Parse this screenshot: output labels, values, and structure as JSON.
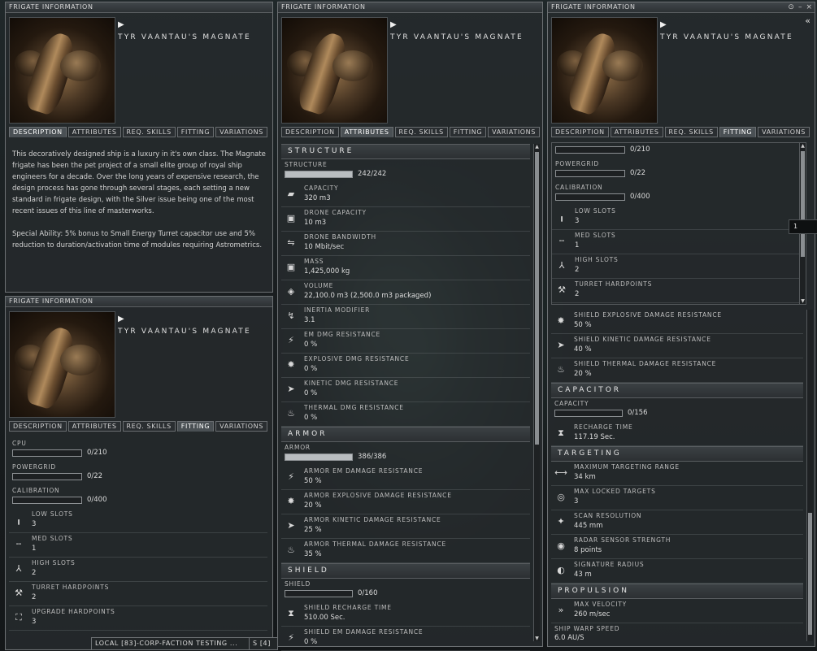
{
  "window_title": "FRIGATE INFORMATION",
  "ship_name": "TYR VAANTAU'S MAGNATE",
  "tabs": [
    "DESCRIPTION",
    "ATTRIBUTES",
    "REQ. SKILLS",
    "FITTING",
    "VARIATIONS"
  ],
  "window_controls": [
    "⊙",
    "–",
    "×"
  ],
  "collapse_glyph": "«",
  "play_glyph": "▶",
  "description": {
    "para1": "This decoratively designed ship is a luxury in it's own class. The Magnate frigate has been the pet project of a small elite group of royal ship engineers for a decade. Over the long years of expensive research, the design process has gone through several stages, each setting a new standard in frigate design, with the Silver issue being one of the most recent issues of this line of masterworks.",
    "para2": "Special Ability: 5% bonus to Small Energy Turret capacitor use and 5% reduction to duration/activation time of modules requiring Astrometrics."
  },
  "fitting": {
    "cpu_label": "CPU",
    "cpu_value": "0/210",
    "cpu_fill": 0,
    "powergrid_label": "POWERGRID",
    "powergrid_value": "0/22",
    "powergrid_fill": 0,
    "calibration_label": "CALIBRATION",
    "calibration_value": "0/400",
    "calibration_fill": 0,
    "low_label": "LOW SLOTS",
    "low_value": "3",
    "med_label": "MED SLOTS",
    "med_value": "1",
    "high_label": "HIGH SLOTS",
    "high_value": "2",
    "turret_label": "TURRET HARDPOINTS",
    "turret_value": "2",
    "upgrade_label": "UPGRADE HARDPOINTS",
    "upgrade_value": "3"
  },
  "attributes": {
    "structure_header": "STRUCTURE",
    "structure_label": "STRUCTURE",
    "structure_value": "242/242",
    "structure_fill": 1.0,
    "structure_rows": [
      {
        "icon": "cargo-icon",
        "glyph": "▰",
        "label": "CAPACITY",
        "value": "320 m3"
      },
      {
        "icon": "drone-capacity-icon",
        "glyph": "▣",
        "label": "DRONE CAPACITY",
        "value": "10 m3"
      },
      {
        "icon": "drone-bandwidth-icon",
        "glyph": "⇋",
        "label": "DRONE BANDWIDTH",
        "value": "10 Mbit/sec"
      },
      {
        "icon": "mass-icon",
        "glyph": "▣",
        "label": "MASS",
        "value": "1,425,000 kg"
      },
      {
        "icon": "volume-icon",
        "glyph": "◈",
        "label": "VOLUME",
        "value": "22,100.0 m3 (2,500.0 m3 packaged)"
      },
      {
        "icon": "inertia-icon",
        "glyph": "↯",
        "label": "INERTIA MODIFIER",
        "value": "3.1"
      },
      {
        "icon": "em-resist-icon",
        "glyph": "⚡",
        "label": "EM DMG RESISTANCE",
        "value": "0 %"
      },
      {
        "icon": "explosive-resist-icon",
        "glyph": "✸",
        "label": "EXPLOSIVE DMG RESISTANCE",
        "value": "0 %"
      },
      {
        "icon": "kinetic-resist-icon",
        "glyph": "➤",
        "label": "KINETIC DMG RESISTANCE",
        "value": "0 %"
      },
      {
        "icon": "thermal-resist-icon",
        "glyph": "♨",
        "label": "THERMAL DMG RESISTANCE",
        "value": "0 %"
      }
    ],
    "armor_header": "ARMOR",
    "armor_label": "ARMOR",
    "armor_value": "386/386",
    "armor_fill": 1.0,
    "armor_rows": [
      {
        "icon": "em-resist-icon",
        "glyph": "⚡",
        "label": "ARMOR EM DAMAGE RESISTANCE",
        "value": "50 %"
      },
      {
        "icon": "explosive-resist-icon",
        "glyph": "✸",
        "label": "ARMOR EXPLOSIVE DAMAGE RESISTANCE",
        "value": "20 %"
      },
      {
        "icon": "kinetic-resist-icon",
        "glyph": "➤",
        "label": "ARMOR KINETIC DAMAGE RESISTANCE",
        "value": "25 %"
      },
      {
        "icon": "thermal-resist-icon",
        "glyph": "♨",
        "label": "ARMOR THERMAL DAMAGE RESISTANCE",
        "value": "35 %"
      }
    ],
    "shield_header": "SHIELD",
    "shield_label": "SHIELD",
    "shield_value": "0/160",
    "shield_fill": 0,
    "shield_rows": [
      {
        "icon": "hourglass-icon",
        "glyph": "⧗",
        "label": "SHIELD RECHARGE TIME",
        "value": "510.00 Sec."
      },
      {
        "icon": "em-resist-icon",
        "glyph": "⚡",
        "label": "SHIELD EM DAMAGE RESISTANCE",
        "value": "0 %"
      }
    ]
  },
  "right_panel": {
    "top_rows": [
      {
        "icon": "explosive-resist-icon",
        "glyph": "✸",
        "label": "SHIELD EXPLOSIVE DAMAGE RESISTANCE",
        "value": "50 %"
      },
      {
        "icon": "kinetic-resist-icon",
        "glyph": "➤",
        "label": "SHIELD KINETIC DAMAGE RESISTANCE",
        "value": "40 %"
      },
      {
        "icon": "thermal-resist-icon",
        "glyph": "♨",
        "label": "SHIELD THERMAL DAMAGE RESISTANCE",
        "value": "20 %"
      }
    ],
    "capacitor_header": "CAPACITOR",
    "capacitor_label": "CAPACITY",
    "capacitor_value": "0/156",
    "capacitor_fill": 0,
    "capacitor_rows": [
      {
        "icon": "hourglass-icon",
        "glyph": "⧗",
        "label": "RECHARGE TIME",
        "value": "117.19 Sec."
      }
    ],
    "targeting_header": "TARGETING",
    "targeting_rows": [
      {
        "icon": "targeting-range-icon",
        "glyph": "⟷",
        "label": "MAXIMUM TARGETING RANGE",
        "value": "34 km"
      },
      {
        "icon": "locked-targets-icon",
        "glyph": "◎",
        "label": "MAX LOCKED TARGETS",
        "value": "3"
      },
      {
        "icon": "scan-resolution-icon",
        "glyph": "✦",
        "label": "SCAN RESOLUTION",
        "value": "445 mm"
      },
      {
        "icon": "radar-icon",
        "glyph": "◉",
        "label": "RADAR SENSOR STRENGTH",
        "value": "8 points"
      },
      {
        "icon": "signature-icon",
        "glyph": "◐",
        "label": "SIGNATURE RADIUS",
        "value": "43 m"
      }
    ],
    "propulsion_header": "PROPULSION",
    "propulsion_rows": [
      {
        "icon": "velocity-icon",
        "glyph": "»",
        "label": "MAX VELOCITY",
        "value": "260 m/sec"
      }
    ],
    "warp_label": "SHIP WARP SPEED",
    "warp_value": "6.0 AU/S"
  },
  "tooltip_value": "1",
  "bottom_chat_tab": "LOCAL [83]-CORP-FACTION TESTING ...",
  "bottom_chat_tab2": "S [4]"
}
